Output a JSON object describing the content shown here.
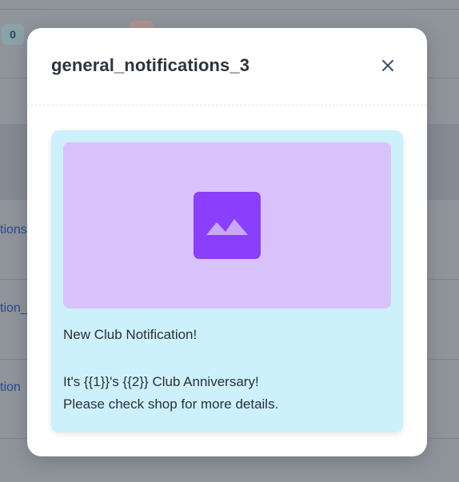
{
  "background": {
    "badge_count": "0",
    "links": [
      "tions",
      "tion_",
      "tion"
    ]
  },
  "modal": {
    "title": "general_notifications_3",
    "close_icon": "close-icon",
    "preview": {
      "media_icon": "image-icon",
      "header_text": "New Club Notification!",
      "body_lines": [
        "It's {{1}}'s {{2}} Club Anniversary!",
        "Please check shop for more details."
      ]
    }
  },
  "colors": {
    "card_background": "#cdf1fb",
    "media_background": "#d9c2fb",
    "media_icon": "#8a3ffc",
    "overlay": "#8f949b"
  }
}
